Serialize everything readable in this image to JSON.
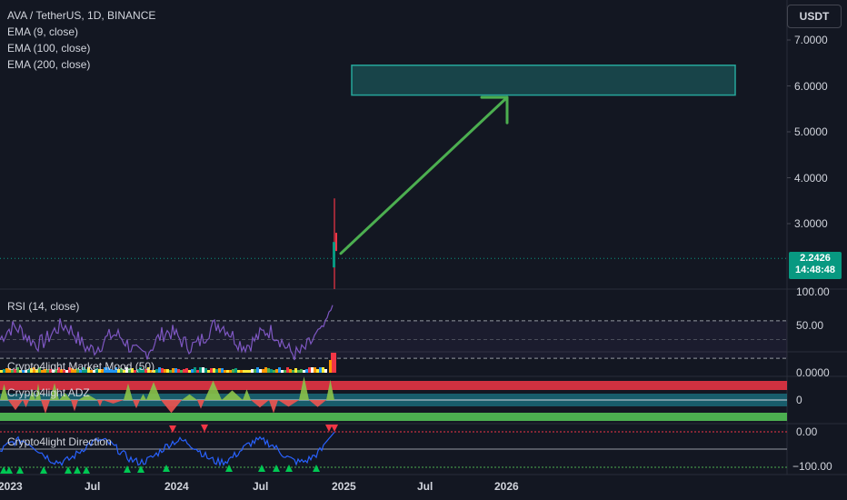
{
  "header": {
    "symbol_line": "AVA / TetherUS, 1D, BINANCE",
    "indicators": [
      "EMA (9, close)",
      "EMA (100, close)",
      "EMA (200, close)"
    ],
    "currency_button": "USDT"
  },
  "price_axis": {
    "ticks": [
      "7.0000",
      "6.0000",
      "5.0000",
      "4.0000",
      "3.0000"
    ],
    "tick_values": [
      7,
      6,
      5,
      4,
      3
    ],
    "last_price": "2.2426",
    "countdown": "14:48:48"
  },
  "panes": {
    "rsi": {
      "label": "RSI (14, close)",
      "axis": [
        "100.00",
        "50.00"
      ],
      "line_color": "#7e57c2"
    },
    "mood": {
      "label": "Crypto4light Market Mood (50)",
      "axis": [
        "0.0000"
      ]
    },
    "adz": {
      "label": "Crypto4light ADZ",
      "axis": [
        "0"
      ]
    },
    "direction": {
      "label": "Crypto4light Direction",
      "axis": [
        "0.00",
        "−100.00"
      ],
      "line_color": "#2962ff"
    }
  },
  "x_axis": [
    "2023",
    "Jul",
    "2024",
    "Jul",
    "2025",
    "Jul",
    "2026"
  ],
  "colors": {
    "background": "#131722",
    "bull": "#089981",
    "bear": "#f23645",
    "annotation": "#4caf50",
    "target_zone": "#26a69a"
  },
  "chart_data": {
    "type": "candlestick",
    "title": "AVA / TetherUS, 1D, BINANCE",
    "price_range": [
      1.75,
      7.4
    ],
    "last_price": 2.2426,
    "spike": {
      "high": 3.55,
      "close": 2.2426
    },
    "target_zone": {
      "low": 5.8,
      "high": 6.45
    },
    "arrow": {
      "from_price": 2.35,
      "to_price": 5.75
    },
    "rsi_levels": [
      70,
      50,
      30
    ],
    "direction_levels": [
      0,
      -100
    ]
  }
}
